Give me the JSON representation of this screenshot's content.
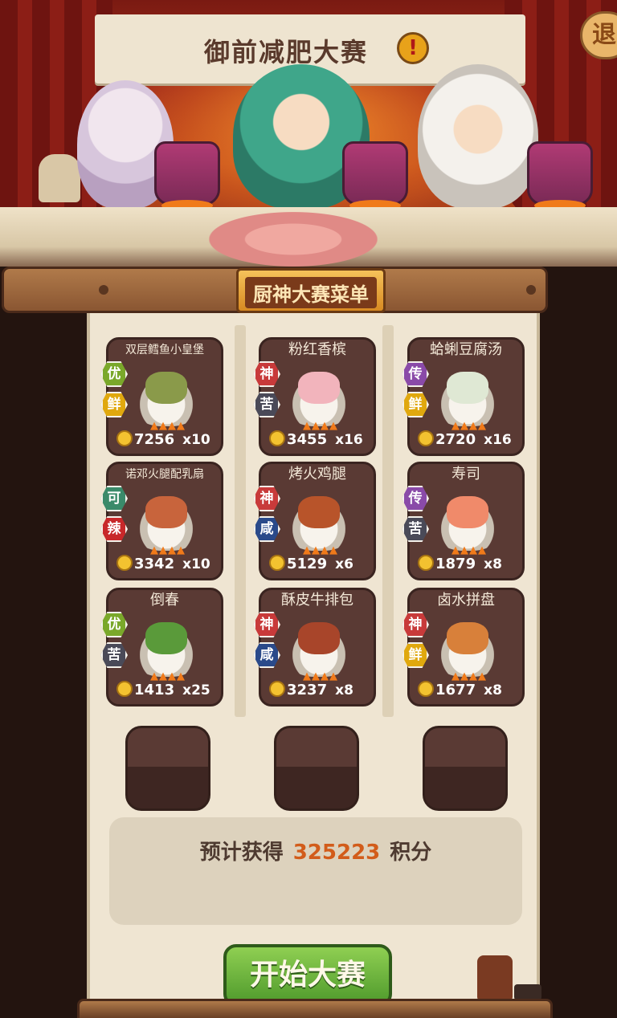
{
  "header": {
    "title": "御前减肥大赛",
    "alert_symbol": "!",
    "exit_label": "退"
  },
  "menu": {
    "title": "厨神大赛菜单",
    "dishes": [
      {
        "name": "双层鳕鱼小皇堡",
        "grade": "优",
        "grade_color": "#7aa82a",
        "taste": "鲜",
        "taste_color": "#e0a80e",
        "coins": "7256",
        "qty": "x10",
        "food_color": "#8a9a4a"
      },
      {
        "name": "粉红香槟",
        "grade": "神",
        "grade_color": "#c83a3a",
        "taste": "苦",
        "taste_color": "#4a4a58",
        "coins": "3455",
        "qty": "x16",
        "food_color": "#f2b4bc"
      },
      {
        "name": "蛤蜊豆腐汤",
        "grade": "传",
        "grade_color": "#8a4aa8",
        "taste": "鲜",
        "taste_color": "#e0a80e",
        "coins": "2720",
        "qty": "x16",
        "food_color": "#dfe8d4"
      },
      {
        "name": "诺邓火腿配乳扇",
        "grade": "可",
        "grade_color": "#3a8a6a",
        "taste": "辣",
        "taste_color": "#c8282a",
        "coins": "3342",
        "qty": "x10",
        "food_color": "#c8643c"
      },
      {
        "name": "烤火鸡腿",
        "grade": "神",
        "grade_color": "#c83a3a",
        "taste": "咸",
        "taste_color": "#2a4a8a",
        "coins": "5129",
        "qty": "x6",
        "food_color": "#b8542a"
      },
      {
        "name": "寿司",
        "grade": "传",
        "grade_color": "#8a4aa8",
        "taste": "苦",
        "taste_color": "#4a4a58",
        "coins": "1879",
        "qty": "x8",
        "food_color": "#f08a6a"
      },
      {
        "name": "倒春",
        "grade": "优",
        "grade_color": "#7aa82a",
        "taste": "苦",
        "taste_color": "#4a4a58",
        "coins": "1413",
        "qty": "x25",
        "food_color": "#5a9a3a"
      },
      {
        "name": "酥皮牛排包",
        "grade": "神",
        "grade_color": "#c83a3a",
        "taste": "咸",
        "taste_color": "#2a4a8a",
        "coins": "3237",
        "qty": "x8",
        "food_color": "#a8452a"
      },
      {
        "name": "卤水拼盘",
        "grade": "神",
        "grade_color": "#c83a3a",
        "taste": "鲜",
        "taste_color": "#e0a80e",
        "coins": "1677",
        "qty": "x8",
        "food_color": "#d8803a"
      }
    ]
  },
  "estimate": {
    "prefix": "预计获得",
    "value": "325223",
    "suffix": "积分"
  },
  "start_button_label": "开始大赛"
}
